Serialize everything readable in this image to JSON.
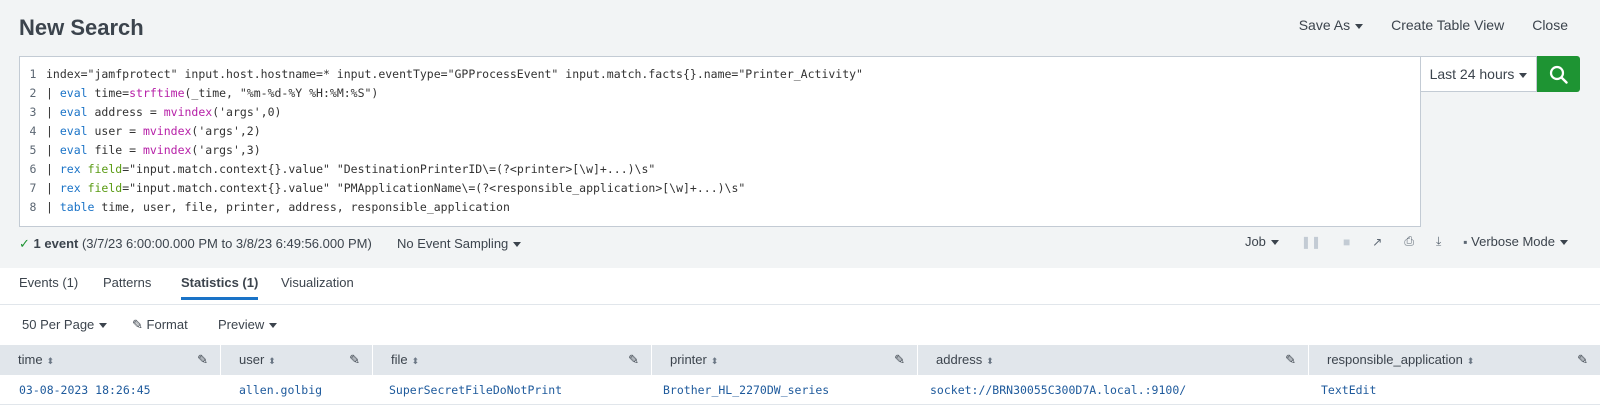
{
  "header": {
    "title": "New Search",
    "actions": {
      "save_as": "Save As",
      "create_table_view": "Create Table View",
      "close": "Close"
    }
  },
  "search": {
    "lines": [
      {
        "num": "1",
        "segments": [
          {
            "t": "index=\"jamfprotect\" input.host.hostname=* input.eventType=\"GPProcessEvent\" input.match.facts{}.name=\"Printer_Activity\"",
            "c": ""
          }
        ]
      },
      {
        "num": "2",
        "segments": [
          {
            "t": "| ",
            "c": ""
          },
          {
            "t": "eval",
            "c": "kw"
          },
          {
            "t": " time=",
            "c": ""
          },
          {
            "t": "strftime",
            "c": "fn"
          },
          {
            "t": "(_time, \"%m-%d-%Y %H:%M:%S\")",
            "c": ""
          }
        ]
      },
      {
        "num": "3",
        "segments": [
          {
            "t": "| ",
            "c": ""
          },
          {
            "t": "eval",
            "c": "kw"
          },
          {
            "t": " address = ",
            "c": ""
          },
          {
            "t": "mvindex",
            "c": "fn"
          },
          {
            "t": "('args',0)",
            "c": ""
          }
        ]
      },
      {
        "num": "4",
        "segments": [
          {
            "t": "| ",
            "c": ""
          },
          {
            "t": "eval",
            "c": "kw"
          },
          {
            "t": " user = ",
            "c": ""
          },
          {
            "t": "mvindex",
            "c": "fn"
          },
          {
            "t": "('args',2)",
            "c": ""
          }
        ]
      },
      {
        "num": "5",
        "segments": [
          {
            "t": "| ",
            "c": ""
          },
          {
            "t": "eval",
            "c": "kw"
          },
          {
            "t": " file = ",
            "c": ""
          },
          {
            "t": "mvindex",
            "c": "fn"
          },
          {
            "t": "('args',3)",
            "c": ""
          }
        ]
      },
      {
        "num": "6",
        "segments": [
          {
            "t": "| ",
            "c": ""
          },
          {
            "t": "rex",
            "c": "kw"
          },
          {
            "t": " ",
            "c": ""
          },
          {
            "t": "field",
            "c": "arg"
          },
          {
            "t": "=\"input.match.context{}.value\" \"DestinationPrinterID\\=(?<printer>[\\w]+...)\\s\"",
            "c": ""
          }
        ]
      },
      {
        "num": "7",
        "segments": [
          {
            "t": "| ",
            "c": ""
          },
          {
            "t": "rex",
            "c": "kw"
          },
          {
            "t": " ",
            "c": ""
          },
          {
            "t": "field",
            "c": "arg"
          },
          {
            "t": "=\"input.match.context{}.value\" \"PMApplicationName\\=(?<responsible_application>[\\w]+...)\\s\"",
            "c": ""
          }
        ]
      },
      {
        "num": "8",
        "segments": [
          {
            "t": "| ",
            "c": ""
          },
          {
            "t": "table",
            "c": "kw"
          },
          {
            "t": " time, user, file, printer, address, responsible_application",
            "c": ""
          }
        ]
      }
    ],
    "time_range": "Last 24 hours",
    "search_icon": "search-icon"
  },
  "status": {
    "check": "✓",
    "count": "1 event",
    "range": "(3/7/23 6:00:00.000 PM to 3/8/23 6:49:56.000 PM)",
    "sampling": "No Event Sampling",
    "job": "Job",
    "mode": "Verbose Mode"
  },
  "tabs": [
    "Events (1)",
    "Patterns",
    "Statistics (1)",
    "Visualization"
  ],
  "active_tab": "Statistics (1)",
  "toolbar": {
    "per_page": "50 Per Page",
    "format": "Format",
    "preview": "Preview"
  },
  "table": {
    "columns": [
      "time",
      "user",
      "file",
      "printer",
      "address",
      "responsible_application"
    ],
    "rows": [
      [
        "03-08-2023 18:26:45",
        "allen.golbig",
        "SuperSecretFileDoNotPrint",
        "Brother_HL_2270DW_series",
        "socket://BRN30055C300D7A.local.:9100/",
        "TextEdit"
      ]
    ]
  },
  "colors": {
    "accent": "#1a73c7",
    "search_button": "#1e9433",
    "link": "#1e5a9c"
  }
}
